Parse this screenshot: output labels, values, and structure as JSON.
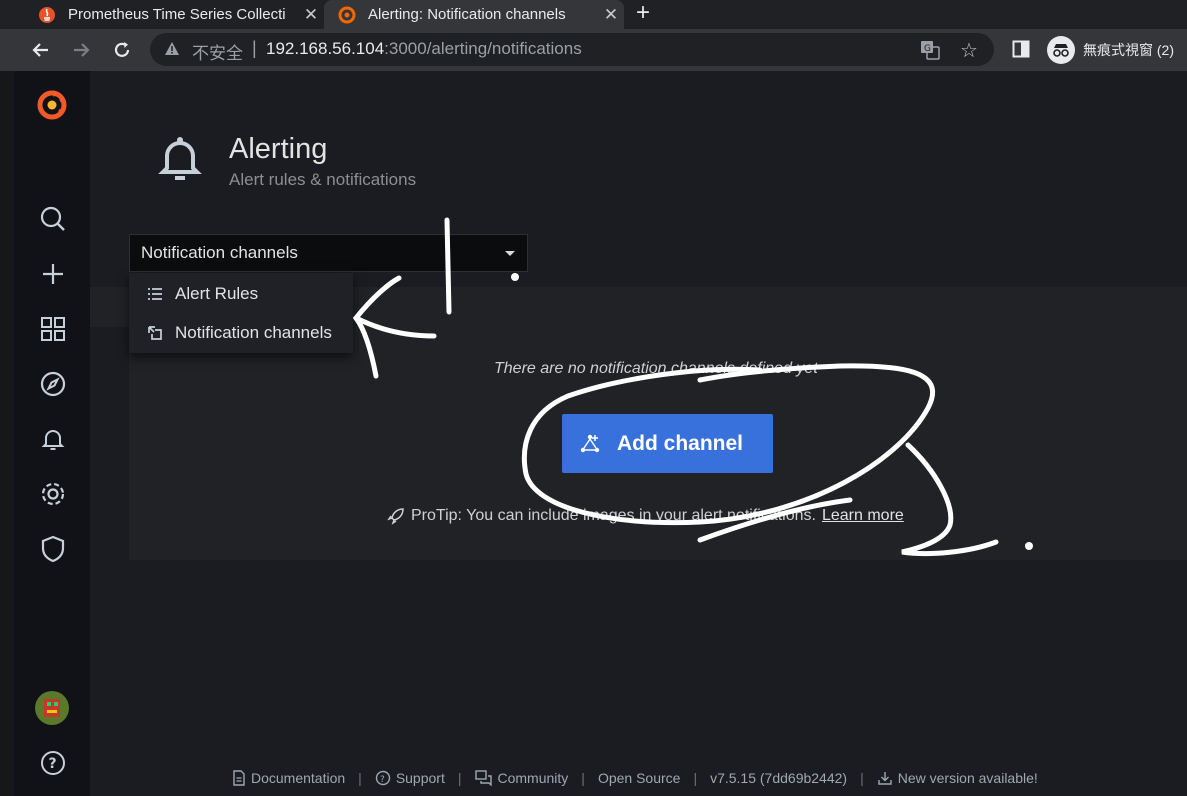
{
  "browser": {
    "tabs": [
      {
        "title": "Prometheus Time Series Collecti",
        "active": false
      },
      {
        "title": "Alerting: Notification channels",
        "active": true
      }
    ],
    "new_tab": "+",
    "insecure_label": "不安全",
    "url_host": "192.168.56.104",
    "url_path": ":3000/alerting/notifications",
    "incognito_label": "無痕式視窗 (2)"
  },
  "sidemenu": {
    "items": [
      "grafana-logo-icon",
      "search-icon",
      "plus-icon",
      "dashboards-icon",
      "explore-icon",
      "alerting-icon",
      "settings-icon",
      "shield-icon",
      "avatar",
      "help-icon"
    ]
  },
  "page": {
    "title": "Alerting",
    "subtitle": "Alert rules & notifications"
  },
  "picker": {
    "selected": "Notification channels",
    "options": [
      {
        "label": "Alert Rules",
        "icon": "list-icon"
      },
      {
        "label": "Notification channels",
        "icon": "channel-icon"
      }
    ]
  },
  "empty": {
    "message": "There are no notification channels defined yet",
    "button": "Add channel",
    "protip": "ProTip: You can include images in your alert notifications.",
    "learn_more": "Learn more"
  },
  "footer": {
    "documentation": "Documentation",
    "support": "Support",
    "community": "Community",
    "open_source": "Open Source",
    "version": "v7.5.15 (7dd69b2442)",
    "new_version": "New version available!"
  },
  "colors": {
    "primary_button": "#3871dc",
    "grafana_orange": "#f05a28"
  }
}
